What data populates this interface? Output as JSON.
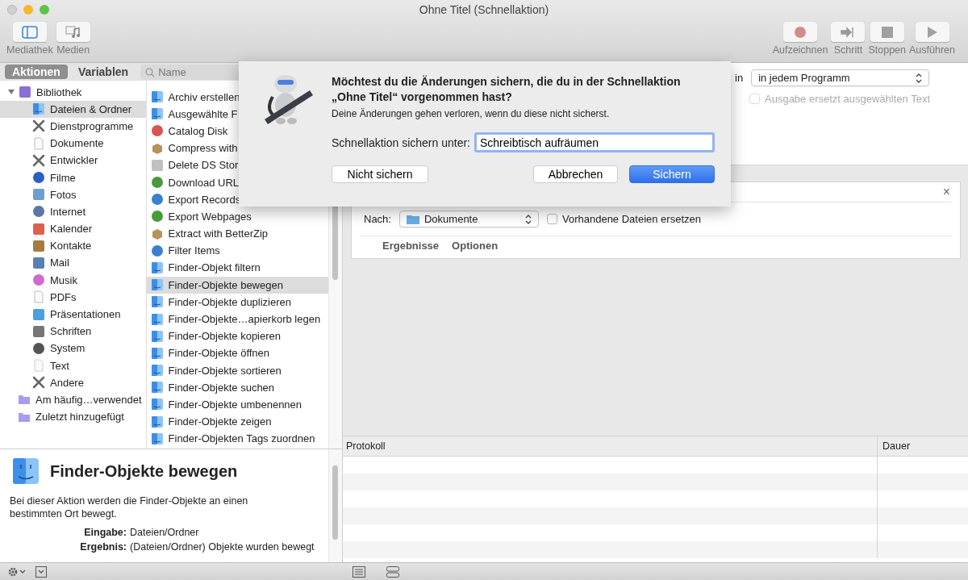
{
  "window": {
    "title": "Ohne Titel (Schnellaktion)"
  },
  "toolbar_left": [
    {
      "label": "Mediathek",
      "kind": "library",
      "selected": true
    },
    {
      "label": "Medien",
      "kind": "media",
      "selected": false
    }
  ],
  "toolbar_right": [
    {
      "label": "Aufzeichnen",
      "kind": "record"
    },
    {
      "label": "Schritt",
      "kind": "step"
    },
    {
      "label": "Stoppen",
      "kind": "stop"
    },
    {
      "label": "Ausführen",
      "kind": "run"
    }
  ],
  "library_tabs": [
    {
      "label": "Aktionen",
      "selected": true
    },
    {
      "label": "Variablen",
      "selected": false
    }
  ],
  "search": {
    "placeholder": "Name"
  },
  "categories": [
    {
      "label": "Bibliothek",
      "kind": "library",
      "expanded": true,
      "selected": false,
      "children": [
        {
          "label": "Dateien & Ordner",
          "kind": "finder",
          "selected": true
        },
        {
          "label": "Dienstprogramme",
          "kind": "tools",
          "selected": false
        },
        {
          "label": "Dokumente",
          "kind": "document",
          "selected": false
        },
        {
          "label": "Entwickler",
          "kind": "tools",
          "selected": false
        },
        {
          "label": "Filme",
          "kind": "movie",
          "selected": false
        },
        {
          "label": "Fotos",
          "kind": "photo",
          "selected": false
        },
        {
          "label": "Internet",
          "kind": "globe",
          "selected": false
        },
        {
          "label": "Kalender",
          "kind": "calendar",
          "selected": false
        },
        {
          "label": "Kontakte",
          "kind": "contacts",
          "selected": false
        },
        {
          "label": "Mail",
          "kind": "mail",
          "selected": false
        },
        {
          "label": "Musik",
          "kind": "music",
          "selected": false
        },
        {
          "label": "PDFs",
          "kind": "document",
          "selected": false
        },
        {
          "label": "Präsentationen",
          "kind": "slides",
          "selected": false
        },
        {
          "label": "Schriften",
          "kind": "fonts",
          "selected": false
        },
        {
          "label": "System",
          "kind": "system",
          "selected": false
        },
        {
          "label": "Text",
          "kind": "text",
          "selected": false
        },
        {
          "label": "Andere",
          "kind": "tools",
          "selected": false
        }
      ]
    },
    {
      "label": "Am häufig…verwendet",
      "kind": "smart_folder",
      "selected": false
    },
    {
      "label": "Zuletzt hinzugefügt",
      "kind": "smart_folder",
      "selected": false
    }
  ],
  "actions": [
    {
      "label": "Archiv erstellen",
      "kind": "finder",
      "selected": false
    },
    {
      "label": "Ausgewählte F",
      "kind": "finder",
      "selected": false
    },
    {
      "label": "Catalog Disk",
      "kind": "disk",
      "selected": false
    },
    {
      "label": "Compress with",
      "kind": "box",
      "selected": false
    },
    {
      "label": "Delete DS Stor",
      "kind": "bottle",
      "selected": false
    },
    {
      "label": "Download URL",
      "kind": "green",
      "selected": false
    },
    {
      "label": "Export Records",
      "kind": "swirl",
      "selected": false
    },
    {
      "label": "Export Webpages",
      "kind": "green",
      "selected": false
    },
    {
      "label": "Extract with BetterZip",
      "kind": "box",
      "selected": false
    },
    {
      "label": "Filter Items",
      "kind": "swirl",
      "selected": false
    },
    {
      "label": "Finder-Objekt filtern",
      "kind": "finder",
      "selected": false
    },
    {
      "label": "Finder-Objekte bewegen",
      "kind": "finder",
      "selected": true
    },
    {
      "label": "Finder-Objekte duplizieren",
      "kind": "finder",
      "selected": false
    },
    {
      "label": "Finder-Objekte…apierkorb legen",
      "kind": "finder",
      "selected": false
    },
    {
      "label": "Finder-Objekte kopieren",
      "kind": "finder",
      "selected": false
    },
    {
      "label": "Finder-Objekte öffnen",
      "kind": "finder",
      "selected": false
    },
    {
      "label": "Finder-Objekte sortieren",
      "kind": "finder",
      "selected": false
    },
    {
      "label": "Finder-Objekte suchen",
      "kind": "finder",
      "selected": false
    },
    {
      "label": "Finder-Objekte umbenennen",
      "kind": "finder",
      "selected": false
    },
    {
      "label": "Finder-Objekte zeigen",
      "kind": "finder",
      "selected": false
    },
    {
      "label": "Finder-Objekten Tags zuordnen",
      "kind": "finder",
      "selected": false
    }
  ],
  "description": {
    "title": "Finder-Objekte bewegen",
    "text": "Bei dieser Aktion werden die Finder-Objekte an einen bestimmten Ort bewegt.",
    "fields": [
      {
        "label": "Eingabe:",
        "value": "Dateien/Ordner"
      },
      {
        "label": "Ergebnis:",
        "value": "(Dateien/Ordner) Objekte wurden bewegt"
      }
    ]
  },
  "workflow_settings": {
    "in_label": "in",
    "application": "in jedem Programm",
    "replace_checkbox": {
      "label": "Ausgabe ersetzt ausgewählten Text",
      "checked": false,
      "disabled": true
    }
  },
  "action_card": {
    "close": "×",
    "destination_label": "Nach:",
    "destination": "Dokumente",
    "replace_checkbox": {
      "label": "Vorhandene Dateien ersetzen",
      "checked": false
    },
    "tabs": [
      "Ergebnisse",
      "Optionen"
    ]
  },
  "log": {
    "columns": [
      "Protokoll",
      "Dauer"
    ]
  },
  "dialog": {
    "title": "Möchtest du die Änderungen sichern, die du in der Schnellaktion „Ohne Titel“ vorgenommen hast?",
    "message": "Deine Änderungen gehen verloren, wenn du diese nicht sicherst.",
    "field_label": "Schnellaktion sichern unter:",
    "field_value": "Schreibtisch aufräumen",
    "buttons": [
      {
        "label": "Nicht sichern",
        "kind": "secondary"
      },
      {
        "label": "Abbrechen",
        "kind": "cancel"
      },
      {
        "label": "Sichern",
        "kind": "default"
      }
    ]
  }
}
